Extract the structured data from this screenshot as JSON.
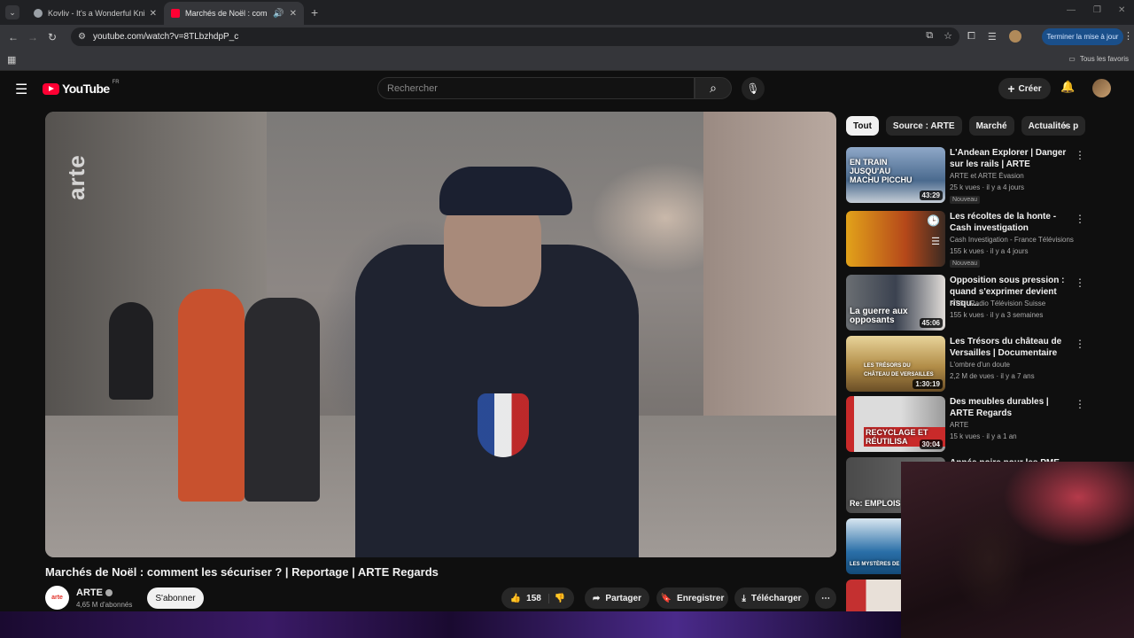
{
  "browser": {
    "tabs": [
      {
        "title": "Kovliv - It's a Wonderful Knife (",
        "active": false,
        "favicon_color": "#9aa0a6"
      },
      {
        "title": "Marchés de Noël : commer",
        "active": true,
        "favicon_color": "#ff0033"
      }
    ],
    "url": "youtube.com/watch?v=8TLbzhdpP_c",
    "update_button": "Terminer la mise à jour",
    "all_bookmarks": "Tous les favoris"
  },
  "masthead": {
    "logo_text": "YouTube",
    "logo_country": "FR",
    "search_placeholder": "Rechercher",
    "create_label": "Créer"
  },
  "video": {
    "watermark": "arte",
    "title": "Marchés de Noël : comment les sécuriser ? | Reportage | ARTE Regards",
    "channel": {
      "name": "ARTE",
      "avatar_text": "arte",
      "subscribers": "4,65 M d'abonnés",
      "subscribe_label": "S'abonner"
    },
    "actions": {
      "likes": "158",
      "share": "Partager",
      "save": "Enregistrer",
      "download": "Télécharger"
    }
  },
  "sidebar": {
    "chips": [
      {
        "label": "Tout",
        "active": true
      },
      {
        "label": "Source : ARTE",
        "active": false
      },
      {
        "label": "Marché",
        "active": false
      },
      {
        "label": "Actualités p",
        "active": false
      }
    ],
    "recommendations": [
      {
        "title": "L'Andean Explorer | Danger sur les rails | ARTE",
        "channel": "ARTE et ARTE Évasion",
        "meta": "25 k vues · il y a 4 jours",
        "badge": "Nouveau",
        "duration": "43:29",
        "thumb_caption": "EN TRAIN JUSQU'AU MACHU PICCHU",
        "thumb_color": "#5e7fa8"
      },
      {
        "title": "Les récoltes de la honte - Cash investigation",
        "channel": "Cash Investigation - France Télévisions",
        "meta": "155 k vues · il y a 4 jours",
        "badge": "Nouveau",
        "duration": "",
        "thumb_caption": "",
        "thumb_color": "#c8701a"
      },
      {
        "title": "Opposition sous pression : quand s'exprimer devient risqu...",
        "channel": "RTS - Radio Télévision Suisse",
        "meta": "155 k vues · il y a 3 semaines",
        "badge": "",
        "duration": "45:06",
        "thumb_caption": "La guerre aux opposants",
        "thumb_color": "#4b5566"
      },
      {
        "title": "Les Trésors du château de Versailles | Documentaire",
        "channel": "L'ombre d'un doute",
        "meta": "2,2 M de vues · il y a 7 ans",
        "badge": "",
        "duration": "1:30:19",
        "thumb_caption": "LES TRÉSORS DU CHÂTEAU DE VERSAILLES",
        "thumb_color": "#b79a5a"
      },
      {
        "title": "Des meubles durables | ARTE Regards",
        "channel": "ARTE",
        "meta": "15 k vues · il y a 1 an",
        "badge": "",
        "duration": "30:04",
        "thumb_caption": "RECYCLAGE ET RÉUTILISA",
        "thumb_color": "#8a8a8a"
      },
      {
        "title": "Année noire pour les PME",
        "channel": "",
        "meta": "",
        "badge": "",
        "duration": "",
        "thumb_caption": "Re: EMPLOIS ME",
        "thumb_color": "#3a3a3a"
      },
      {
        "title": "",
        "channel": "",
        "meta": "",
        "badge": "",
        "duration": "",
        "thumb_caption": "LES MYSTÈRES DE",
        "thumb_color": "#2a6fa8"
      },
      {
        "title": "",
        "channel": "",
        "meta": "",
        "badge": "",
        "duration": "",
        "thumb_caption": "",
        "thumb_color": "#c43030"
      }
    ]
  }
}
